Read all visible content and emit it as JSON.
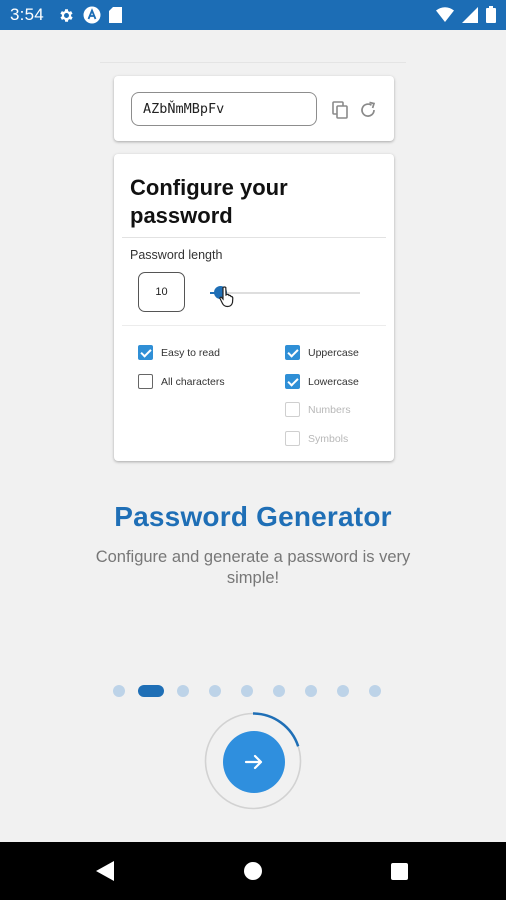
{
  "status_bar": {
    "time": "3:54",
    "left_icons": [
      "settings-gear-icon",
      "a-badge-icon",
      "sim-card-icon"
    ],
    "right_icons": [
      "wifi-icon",
      "signal-icon",
      "battery-icon"
    ]
  },
  "password_preview": {
    "value": "AZbŇmMBpFv",
    "icons": [
      "copy-icon",
      "refresh-icon"
    ]
  },
  "configure_card": {
    "title": "Configure your password",
    "length_label": "Password length",
    "length_value": "10",
    "slider_fraction": 0.07,
    "options_left": [
      {
        "label": "Easy to read",
        "checked": true,
        "disabled": false
      },
      {
        "label": "All characters",
        "checked": false,
        "disabled": false
      }
    ],
    "options_right": [
      {
        "label": "Uppercase",
        "checked": true,
        "disabled": false
      },
      {
        "label": "Lowercase",
        "checked": true,
        "disabled": false
      },
      {
        "label": "Numbers",
        "checked": false,
        "disabled": true
      },
      {
        "label": "Symbols",
        "checked": false,
        "disabled": true
      }
    ]
  },
  "onboarding": {
    "headline": "Password Generator",
    "subtitle": "Configure and generate a password is very simple!",
    "page_count": 9,
    "active_page_index": 1,
    "progress_fraction": 0.2
  },
  "colors": {
    "status_bar": "#1c6db5",
    "accent": "#1f6fb6",
    "button": "#2f8fde",
    "checkbox": "#2f8fd6",
    "inactive_dot": "#bdd3e8",
    "background": "#f1f1f1"
  },
  "nav_bar": {
    "icons": [
      "back-triangle-icon",
      "home-circle-icon",
      "recents-square-icon"
    ]
  }
}
